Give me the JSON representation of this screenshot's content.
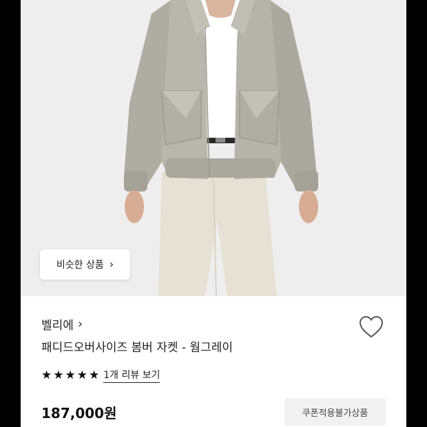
{
  "photo": {
    "description_icon": "product-photo",
    "similar_button": {
      "label": "비슷한 상품",
      "icon": "chevron-right-icon"
    }
  },
  "product": {
    "brand": "벨리에",
    "brand_icon": "chevron-right-icon",
    "name": "패디드오버사이즈 봄버 자켓 - 웜그레이",
    "rating_stars": 5,
    "review_link": "1개 리뷰 보기",
    "price": "187,000원",
    "coupon_badge": "쿠폰적용불가상품",
    "wishlist_icon": "heart-outline-icon"
  },
  "colors": {
    "background": "#ffffff",
    "text": "#222222",
    "badge_bg": "#f2f2f2"
  }
}
